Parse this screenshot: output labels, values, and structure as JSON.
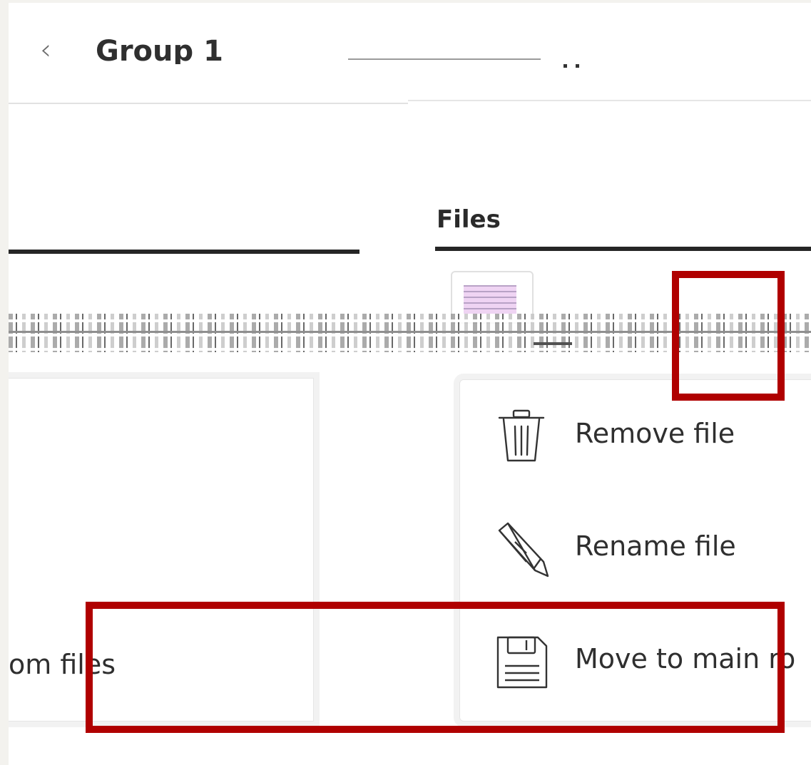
{
  "header": {
    "title": "Group 1"
  },
  "tabs": {
    "files_label": "Files"
  },
  "left_card": {
    "text": "om files"
  },
  "context_menu": {
    "items": [
      {
        "label": "Remove file",
        "icon": "trash-icon"
      },
      {
        "label": "Rename file",
        "icon": "pencil-icon"
      },
      {
        "label": "Move to main ro",
        "icon": "floppy-disk-icon"
      }
    ]
  },
  "annotations": {
    "highlight_color": "#b00000"
  }
}
